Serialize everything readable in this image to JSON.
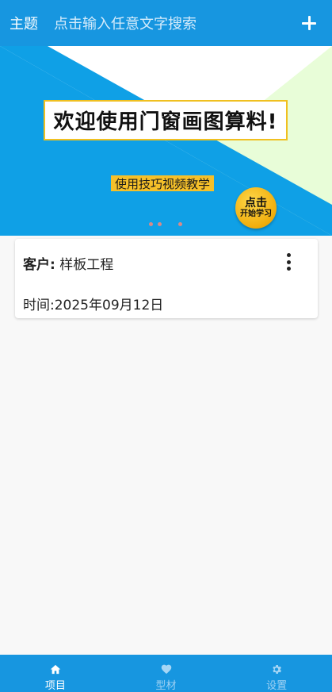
{
  "header": {
    "theme_label": "主题",
    "search_placeholder": "点击输入任意文字搜索",
    "add_icon": "plus-icon"
  },
  "banner": {
    "headline": "欢迎使用门窗画图算料!",
    "sub_label": "使用技巧视频教学",
    "cta_line1": "点击",
    "cta_line2": "开始学习",
    "colors": {
      "blue": "#0fa0e6",
      "green": "#e8fdd8",
      "yellow": "#f5c02a"
    }
  },
  "project": {
    "customer_label": "客户:",
    "customer_value": "样板工程",
    "time_label": "时间:",
    "time_value": "2025年09月12日",
    "more_icon": "more-vertical-icon"
  },
  "bottom_nav": {
    "items": [
      {
        "label": "项目",
        "icon": "home-icon",
        "active": true
      },
      {
        "label": "型材",
        "icon": "heart-icon",
        "active": false
      },
      {
        "label": "设置",
        "icon": "gear-icon",
        "active": false
      }
    ]
  },
  "colors": {
    "primary": "#1796e0",
    "background": "#f8f8f8"
  }
}
